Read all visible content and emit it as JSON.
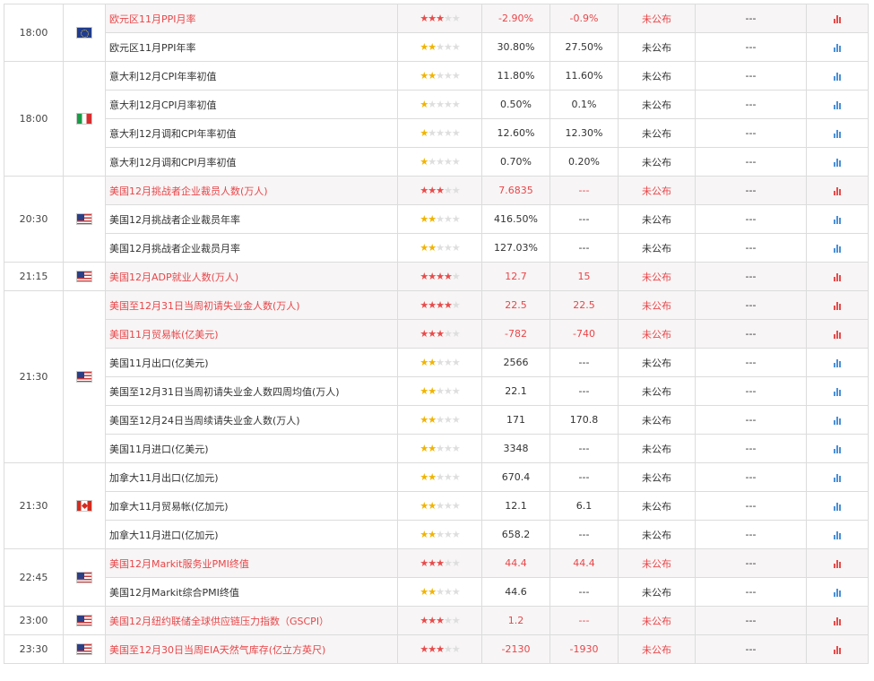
{
  "colors": {
    "important_text": "#e8464a",
    "star_gold": "#f0b400",
    "star_red": "#e84b4b",
    "chart_icon_red": "#e84b4b",
    "chart_icon_blue": "#4a90d9"
  },
  "rows": [
    {
      "time": "18:00",
      "span": 2,
      "flag": "eu",
      "name": "欧元区11月PPI月率",
      "stars": 3,
      "actual": "-2.90%",
      "forecast": "-0.9%",
      "previous": "未公布",
      "revised": "---",
      "important": true
    },
    {
      "name": "欧元区11月PPI年率",
      "stars": 2,
      "actual": "30.80%",
      "forecast": "27.50%",
      "previous": "未公布",
      "revised": "---",
      "important": false
    },
    {
      "time": "18:00",
      "span": 4,
      "flag": "it",
      "name": "意大利12月CPI年率初值",
      "stars": 2,
      "actual": "11.80%",
      "forecast": "11.60%",
      "previous": "未公布",
      "revised": "---",
      "important": false
    },
    {
      "name": "意大利12月CPI月率初值",
      "stars": 1,
      "actual": "0.50%",
      "forecast": "0.1%",
      "previous": "未公布",
      "revised": "---",
      "important": false
    },
    {
      "name": "意大利12月调和CPI年率初值",
      "stars": 1,
      "actual": "12.60%",
      "forecast": "12.30%",
      "previous": "未公布",
      "revised": "---",
      "important": false
    },
    {
      "name": "意大利12月调和CPI月率初值",
      "stars": 1,
      "actual": "0.70%",
      "forecast": "0.20%",
      "previous": "未公布",
      "revised": "---",
      "important": false
    },
    {
      "time": "20:30",
      "span": 3,
      "flag": "us",
      "name": "美国12月挑战者企业裁员人数(万人)",
      "stars": 3,
      "actual": "7.6835",
      "forecast": "---",
      "previous": "未公布",
      "revised": "---",
      "important": true
    },
    {
      "name": "美国12月挑战者企业裁员年率",
      "stars": 2,
      "actual": "416.50%",
      "forecast": "---",
      "previous": "未公布",
      "revised": "---",
      "important": false
    },
    {
      "name": "美国12月挑战者企业裁员月率",
      "stars": 2,
      "actual": "127.03%",
      "forecast": "---",
      "previous": "未公布",
      "revised": "---",
      "important": false
    },
    {
      "time": "21:15",
      "span": 1,
      "flag": "us",
      "name": "美国12月ADP就业人数(万人)",
      "stars": 4,
      "actual": "12.7",
      "forecast": "15",
      "previous": "未公布",
      "revised": "---",
      "important": true
    },
    {
      "time": "21:30",
      "span": 6,
      "flag": "us",
      "name": "美国至12月31日当周初请失业金人数(万人)",
      "stars": 4,
      "actual": "22.5",
      "forecast": "22.5",
      "previous": "未公布",
      "revised": "---",
      "important": true
    },
    {
      "name": "美国11月贸易帐(亿美元)",
      "stars": 3,
      "actual": "-782",
      "forecast": "-740",
      "previous": "未公布",
      "revised": "---",
      "important": true
    },
    {
      "name": "美国11月出口(亿美元)",
      "stars": 2,
      "actual": "2566",
      "forecast": "---",
      "previous": "未公布",
      "revised": "---",
      "important": false
    },
    {
      "name": "美国至12月31日当周初请失业金人数四周均值(万人)",
      "stars": 2,
      "actual": "22.1",
      "forecast": "---",
      "previous": "未公布",
      "revised": "---",
      "important": false
    },
    {
      "name": "美国至12月24日当周续请失业金人数(万人)",
      "stars": 2,
      "actual": "171",
      "forecast": "170.8",
      "previous": "未公布",
      "revised": "---",
      "important": false
    },
    {
      "name": "美国11月进口(亿美元)",
      "stars": 2,
      "actual": "3348",
      "forecast": "---",
      "previous": "未公布",
      "revised": "---",
      "important": false
    },
    {
      "time": "21:30",
      "span": 3,
      "flag": "ca",
      "name": "加拿大11月出口(亿加元)",
      "stars": 2,
      "actual": "670.4",
      "forecast": "---",
      "previous": "未公布",
      "revised": "---",
      "important": false
    },
    {
      "name": "加拿大11月贸易帐(亿加元)",
      "stars": 2,
      "actual": "12.1",
      "forecast": "6.1",
      "previous": "未公布",
      "revised": "---",
      "important": false
    },
    {
      "name": "加拿大11月进口(亿加元)",
      "stars": 2,
      "actual": "658.2",
      "forecast": "---",
      "previous": "未公布",
      "revised": "---",
      "important": false
    },
    {
      "time": "22:45",
      "span": 2,
      "flag": "us",
      "name": "美国12月Markit服务业PMI终值",
      "stars": 3,
      "actual": "44.4",
      "forecast": "44.4",
      "previous": "未公布",
      "revised": "---",
      "important": true
    },
    {
      "name": "美国12月Markit综合PMI终值",
      "stars": 2,
      "actual": "44.6",
      "forecast": "---",
      "previous": "未公布",
      "revised": "---",
      "important": false
    },
    {
      "time": "23:00",
      "span": 1,
      "flag": "us",
      "name": "美国12月纽约联储全球供应链压力指数（GSCPI）",
      "stars": 3,
      "actual": "1.2",
      "forecast": "---",
      "previous": "未公布",
      "revised": "---",
      "important": true
    },
    {
      "time": "23:30",
      "span": 1,
      "flag": "us",
      "name": "美国至12月30日当周EIA天然气库存(亿立方英尺)",
      "stars": 3,
      "actual": "-2130",
      "forecast": "-1930",
      "previous": "未公布",
      "revised": "---",
      "important": true
    }
  ]
}
